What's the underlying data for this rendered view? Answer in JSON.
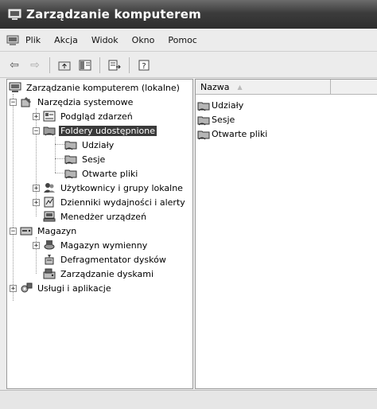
{
  "window": {
    "title": "Zarządzanie komputerem",
    "icon": "computer-icon"
  },
  "menu": {
    "items": [
      "Plik",
      "Akcja",
      "Widok",
      "Okno",
      "Pomoc"
    ],
    "icon": "computer-icon"
  },
  "toolbar": {
    "buttons": [
      "back-arrow-icon",
      "forward-arrow-icon",
      "up-folder-icon",
      "show-hide-tree-icon",
      "export-list-icon",
      "help-icon"
    ]
  },
  "tree": {
    "root": "Zarządzanie komputerem (lokalne)",
    "system_tools": "Narzędzia systemowe",
    "event_viewer": "Podgląd zdarzeń",
    "shared_folders": "Foldery udostępnione",
    "shares": "Udziały",
    "sessions": "Sesje",
    "open_files": "Otwarte pliki",
    "local_users": "Użytkownicy i grupy lokalne",
    "perf_logs": "Dzienniki wydajności i alerty",
    "device_manager": "Menedżer urządzeń",
    "storage": "Magazyn",
    "removable_storage": "Magazyn wymienny",
    "defrag": "Defragmentator dysków",
    "disk_mgmt": "Zarządzanie dyskami",
    "services_apps": "Usługi i aplikacje",
    "selected": "Foldery udostępnione"
  },
  "list": {
    "column_name": "Nazwa",
    "items": [
      "Udziały",
      "Sesje",
      "Otwarte pliki"
    ]
  },
  "colors": {
    "selection": "#3a3a3a",
    "titlebar": "#3c3c3c"
  }
}
